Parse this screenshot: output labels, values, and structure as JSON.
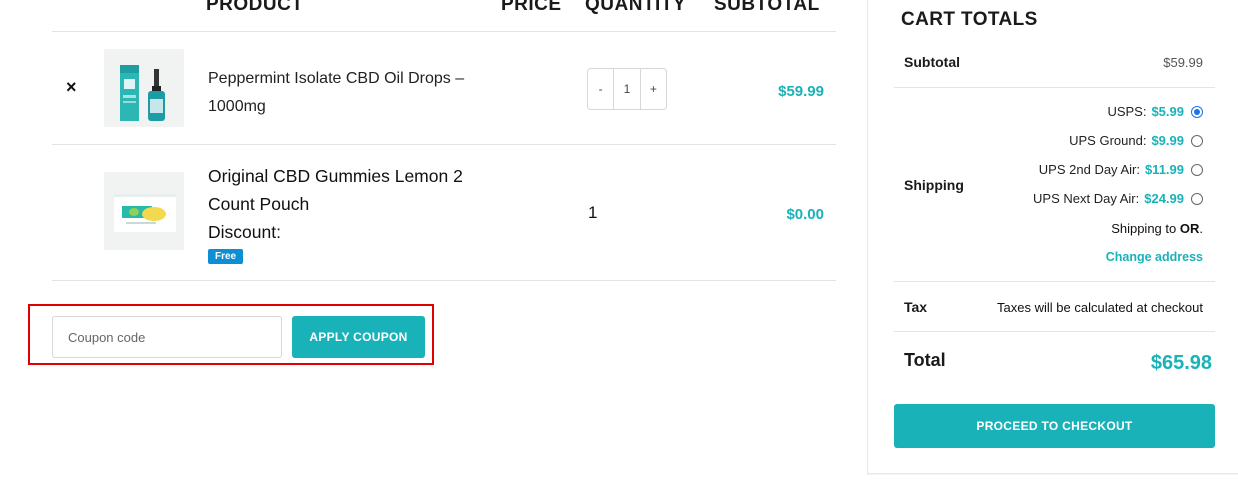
{
  "table": {
    "headers": {
      "product": "PRODUCT",
      "price": "PRICE",
      "quantity": "QUANTITY",
      "subtotal": "SUBTOTAL"
    }
  },
  "items": [
    {
      "remove_icon": "×",
      "image_icon": "cbd-oil-bottle",
      "name": "Peppermint Isolate CBD Oil Drops – 1000mg",
      "quantity": "1",
      "minus": "-",
      "plus": "+",
      "subtotal": "$59.99"
    },
    {
      "image_icon": "gummies-pouch",
      "name": "Original CBD Gummies Lemon 2 Count Pouch",
      "discount_label": "Discount:",
      "badge": "Free",
      "quantity": "1",
      "subtotal": "$0.00"
    }
  ],
  "coupon": {
    "placeholder": "Coupon code",
    "value": "",
    "button_label": "APPLY COUPON"
  },
  "totals": {
    "title": "CART TOTALS",
    "subtotal_label": "Subtotal",
    "subtotal_value": "$59.99",
    "shipping_label": "Shipping",
    "shipping_options": [
      {
        "label": "USPS:",
        "price": "$5.99",
        "selected": true
      },
      {
        "label": "UPS Ground:",
        "price": "$9.99",
        "selected": false
      },
      {
        "label": "UPS 2nd Day Air:",
        "price": "$11.99",
        "selected": false
      },
      {
        "label": "UPS Next Day Air:",
        "price": "$24.99",
        "selected": false
      }
    ],
    "shipping_to_prefix": "Shipping to",
    "shipping_to_state": "OR",
    "shipping_to_suffix": ".",
    "change_address": "Change address",
    "tax_label": "Tax",
    "tax_value": "Taxes will be calculated at checkout",
    "total_label": "Total",
    "total_value": "$65.98",
    "checkout_button": "PROCEED TO CHECKOUT"
  },
  "colors": {
    "accent": "#1ab2b9",
    "badge": "#0d8fd4",
    "highlight_box": "#e00000",
    "radio": "#1a73e8"
  }
}
